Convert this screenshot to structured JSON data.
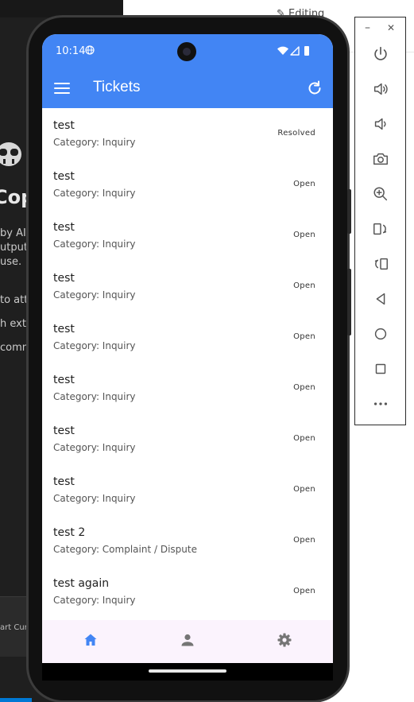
{
  "background": {
    "editor_tab_label": "Editing",
    "copilot_title": "Cop",
    "copilot_lines": [
      "by AI,",
      "utput c",
      "use.",
      "to atta",
      "h exte",
      "comm"
    ],
    "bottom_input_text": "art  Curr"
  },
  "emulator_toolbar": {
    "minimize_label": "–",
    "close_label": "✕",
    "buttons": [
      {
        "icon": "power-icon"
      },
      {
        "icon": "volume-up-icon"
      },
      {
        "icon": "volume-down-icon"
      },
      {
        "icon": "camera-icon"
      },
      {
        "icon": "zoom-in-icon"
      },
      {
        "icon": "rotate-left-icon"
      },
      {
        "icon": "rotate-right-icon"
      },
      {
        "icon": "back-icon"
      },
      {
        "icon": "home-icon"
      },
      {
        "icon": "overview-icon"
      },
      {
        "icon": "more-icon"
      }
    ]
  },
  "status_bar": {
    "time": "10:14"
  },
  "app_bar": {
    "title": "Tickets",
    "color": "#4285f4"
  },
  "tickets": [
    {
      "title": "test",
      "category": "Category: Inquiry",
      "status": "Resolved"
    },
    {
      "title": "test",
      "category": "Category: Inquiry",
      "status": "Open"
    },
    {
      "title": "test",
      "category": "Category: Inquiry",
      "status": "Open"
    },
    {
      "title": "test",
      "category": "Category: Inquiry",
      "status": "Open"
    },
    {
      "title": "test",
      "category": "Category: Inquiry",
      "status": "Open"
    },
    {
      "title": "test",
      "category": "Category: Inquiry",
      "status": "Open"
    },
    {
      "title": "test",
      "category": "Category: Inquiry",
      "status": "Open"
    },
    {
      "title": "test",
      "category": "Category: Inquiry",
      "status": "Open"
    },
    {
      "title": "test 2",
      "category": "Category: Complaint / Dispute",
      "status": "Open"
    },
    {
      "title": "test again",
      "category": "Category: Inquiry",
      "status": "Open"
    }
  ],
  "bottom_nav": {
    "items": [
      {
        "icon": "home-icon",
        "active": true
      },
      {
        "icon": "person-icon",
        "active": false
      },
      {
        "icon": "settings-icon",
        "active": false
      }
    ],
    "active_color": "#4285f4",
    "inactive_color": "#757575"
  }
}
